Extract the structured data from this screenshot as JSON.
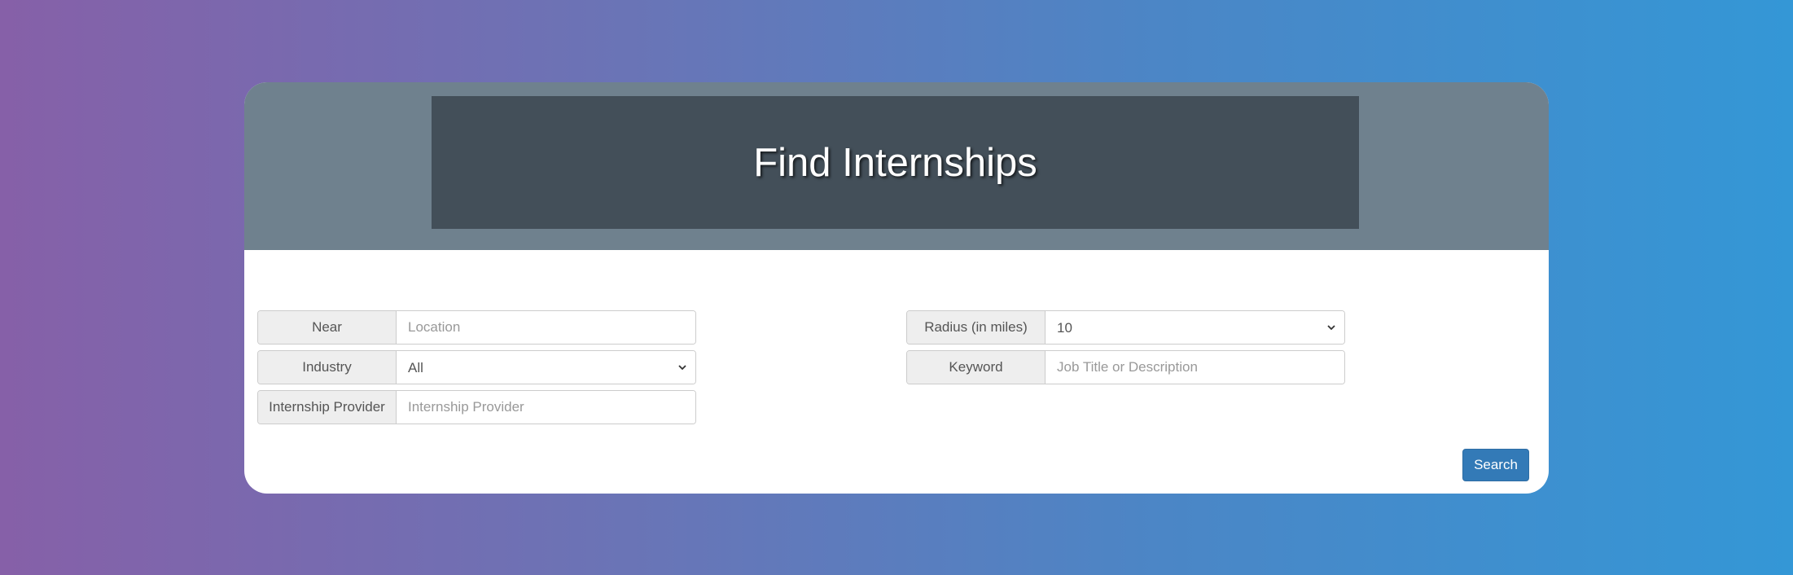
{
  "header": {
    "title": "Find Internships"
  },
  "form": {
    "near": {
      "label": "Near",
      "placeholder": "Location",
      "value": ""
    },
    "radius": {
      "label": "Radius (in miles)",
      "selected": "10",
      "icon": "chevron-down-icon"
    },
    "industry": {
      "label": "Industry",
      "selected": "All",
      "icon": "chevron-down-icon"
    },
    "keyword": {
      "label": "Keyword",
      "placeholder": "Job Title or Description",
      "value": ""
    },
    "provider": {
      "label": "Internship Provider",
      "placeholder": "Internship Provider",
      "value": ""
    },
    "search_label": "Search"
  },
  "colors": {
    "background_left": "#8660a8",
    "background_right": "#3497d6",
    "header_band": "#6f818e",
    "title_box": "#434f59",
    "primary_button": "#337ab7"
  }
}
